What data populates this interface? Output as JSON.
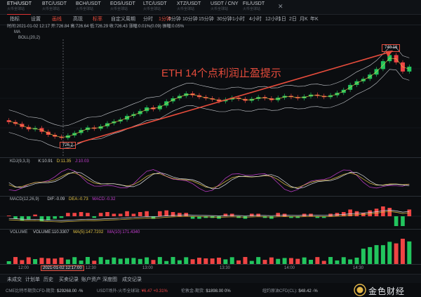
{
  "tabs": [
    {
      "name": "ETH/USDT",
      "sub": "火币全球站"
    },
    {
      "name": "BTC/USDT",
      "sub": "火币全球站"
    },
    {
      "name": "BCH/USDT",
      "sub": "火币全球站"
    },
    {
      "name": "EOS/USDT",
      "sub": "火币全球站"
    },
    {
      "name": "LTC/USDT",
      "sub": "火币全球站"
    },
    {
      "name": "XTZ/USDT",
      "sub": "火币全球站"
    },
    {
      "name": "USDT / CNY",
      "sub": "火币全球站"
    },
    {
      "name": "FIL/USDT",
      "sub": "火币全球站"
    }
  ],
  "toolbar": {
    "indicator": "指标",
    "settings": "设置",
    "draw": "画线",
    "hires": "高现",
    "fullscreen": "标率",
    "custom_period": "自定义周期",
    "periods": [
      "分时",
      "1分钟",
      "5分钟",
      "10分钟",
      "15分钟",
      "30分钟",
      "1小时",
      "4小时",
      "12小时",
      "1日",
      "2日",
      "月K",
      "年K"
    ],
    "active_period": "1分钟"
  },
  "info": {
    "line1": "时间:2021-01-02 12:17  开:726.84  高:726.64  低:726.29  收:726.43  涨幅:0.01%(0.09)  振幅:0.05%",
    "ma": "MA",
    "boll": "BOLL(20,2)",
    "low_tag": "726.2",
    "high_tag": "740.16",
    "annotation": "ETH  14个点利润止盈提示"
  },
  "panes": {
    "kdj": {
      "name": "KDJ(9,3,3)",
      "k": "K:10.91",
      "d": "D:11.35",
      "j": "J:10.03"
    },
    "macd": {
      "name": "MACD(12,26,9)",
      "dif": "DIF:-0.09",
      "dea": "DEA:-0.73",
      "macd": "MACD:-0.32"
    },
    "vol": {
      "name": "VOLUME",
      "vol": "VOLUME:110.3307",
      "ma5": "MA(5):147.7202",
      "ma10": "MA(10):171.4340"
    }
  },
  "xaxis": {
    "labels": [
      "12:00",
      "12:30",
      "13:00",
      "13:30",
      "14:00",
      "14:30"
    ],
    "cursor": "2021-01-02 12:17:00"
  },
  "bottom": {
    "items": [
      "未成交",
      "计划单",
      "历史",
      "买卖记录",
      "账户资产",
      "深度图",
      "成交记录"
    ]
  },
  "ticker": {
    "items": [
      {
        "k": "CME比特币期货CFD-期货:",
        "v": "$29268.00",
        "c": "-%",
        "cls": "v"
      },
      {
        "k": "USDT场外-火币全球站:",
        "v": "¥6.47",
        "c": "+0.31%",
        "cls": "r"
      },
      {
        "k": "伦敦金-期货:",
        "v": "$1898.00",
        "c": "0%",
        "cls": "v"
      },
      {
        "k": "纽约原油CFD(CL):",
        "v": "$48.42",
        "c": "-%",
        "cls": "v"
      }
    ],
    "logo": "金色财经"
  },
  "chart_data": {
    "type": "candlestick",
    "series": [
      {
        "values": [
          729.1,
          728.8,
          728.3,
          727.9,
          728.1,
          727.5,
          727.0,
          726.7,
          726.5,
          726.9,
          727.3,
          727.8,
          728.2,
          728.0,
          728.4,
          728.9,
          729.2,
          729.5,
          730.1,
          730.4,
          730.9,
          731.5,
          731.2,
          731.8,
          732.5,
          733.0,
          733.4,
          733.8,
          733.5,
          733.2,
          733.0,
          732.8,
          732.5,
          732.8,
          733.1,
          732.9,
          732.6,
          732.9,
          733.2,
          733.0,
          732.7,
          733.1,
          733.4,
          733.2,
          733.0,
          733.3,
          733.6,
          733.4,
          733.2,
          733.5,
          733.9,
          734.4,
          735.2,
          735.8,
          736.2,
          736.9,
          737.8,
          739.1,
          740.1,
          738.9,
          737.4,
          738.2
        ]
      }
    ]
  }
}
